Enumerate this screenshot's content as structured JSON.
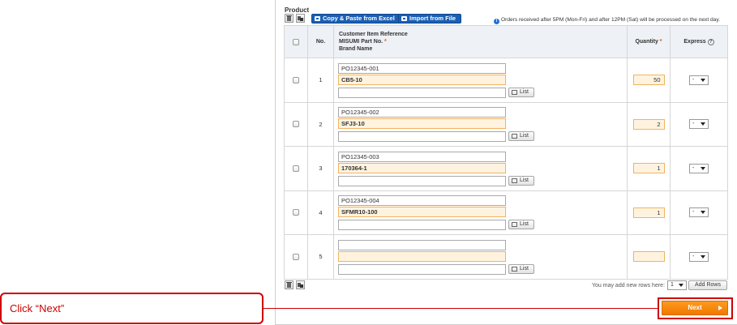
{
  "section": {
    "title": "Product"
  },
  "toolbar": {
    "copy_paste_label": "Copy & Paste from Excel",
    "import_label": "Import from File",
    "notice": "Orders received after 5PM (Mon-Fri) and after 12PM (Sat) will be processed on the next day.",
    "info_glyph": "i",
    "icons": [
      "trash-icon",
      "copy-rows-icon"
    ]
  },
  "table": {
    "headers": {
      "no": "No.",
      "reference": "Customer Item Reference",
      "part_no": "MISUMI Part No.",
      "brand": "Brand Name",
      "quantity": "Quantity",
      "express": "Express",
      "required_mark": "*",
      "help_glyph": "?"
    },
    "rows": [
      {
        "no": "1",
        "reference": "PO12345-001",
        "part_no": "CB5-10",
        "brand": "",
        "quantity": "50",
        "express": "-"
      },
      {
        "no": "2",
        "reference": "PO12345-002",
        "part_no": "SFJ3-10",
        "brand": "",
        "quantity": "2",
        "express": "-"
      },
      {
        "no": "3",
        "reference": "PO12345-003",
        "part_no": "170364-1",
        "brand": "",
        "quantity": "1",
        "express": "-"
      },
      {
        "no": "4",
        "reference": "PO12345-004",
        "part_no": "SFMR10-100",
        "brand": "",
        "quantity": "1",
        "express": "-"
      },
      {
        "no": "5",
        "reference": "",
        "part_no": "",
        "brand": "",
        "quantity": "",
        "express": "-"
      }
    ],
    "list_button_label": "List"
  },
  "footer": {
    "add_rows_text": "You may add new rows here:",
    "add_rows_count": "1",
    "add_rows_label": "Add Rows"
  },
  "next_button": {
    "label": "Next"
  },
  "callout": {
    "text": "Click “Next”"
  },
  "colors": {
    "accent_blue": "#1a5fb4",
    "next_orange": "#f07800",
    "highlight_red": "#cc0000",
    "required_field": "#fff3e0"
  }
}
